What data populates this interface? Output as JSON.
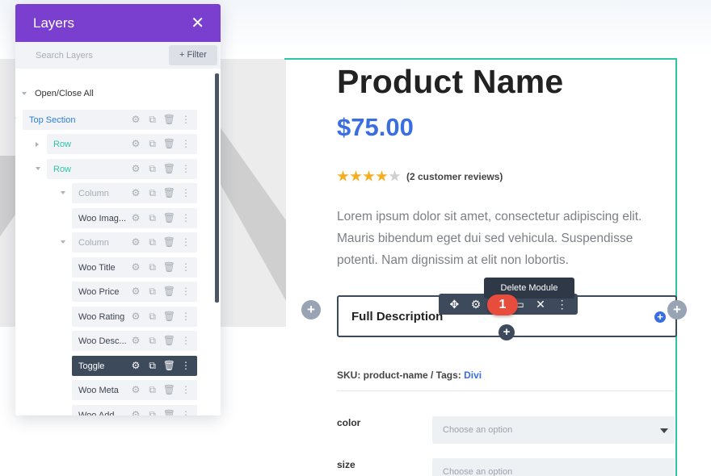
{
  "layers_panel": {
    "title": "Layers",
    "close_icon": "close-icon",
    "search_placeholder": "Search Layers",
    "filter_label": "+ Filter",
    "open_close_all": "Open/Close All",
    "items": [
      {
        "label": "Top Section",
        "type": "section",
        "expanded": true
      },
      {
        "label": "Row",
        "type": "row",
        "expanded": false
      },
      {
        "label": "Row",
        "type": "row",
        "expanded": true
      },
      {
        "label": "Column",
        "type": "column",
        "expanded": true
      },
      {
        "label": "Woo Imag...",
        "type": "module"
      },
      {
        "label": "Column",
        "type": "column",
        "expanded": true
      },
      {
        "label": "Woo Title",
        "type": "module"
      },
      {
        "label": "Woo Price",
        "type": "module"
      },
      {
        "label": "Woo Rating",
        "type": "module"
      },
      {
        "label": "Woo Desc...",
        "type": "module"
      },
      {
        "label": "Toggle",
        "type": "module",
        "active": true
      },
      {
        "label": "Woo Meta",
        "type": "module"
      },
      {
        "label": "Woo Add...",
        "type": "module"
      }
    ],
    "action_icons": [
      "gear-icon",
      "duplicate-icon",
      "trash-icon",
      "more-vertical-icon"
    ]
  },
  "product": {
    "name": "Product Name",
    "price": "$75.00",
    "rating": 4,
    "rating_max": 5,
    "reviews": "(2 customer reviews)",
    "description": "Lorem ipsum dolor sit amet, consectetur adipiscing elit. Mauris bibendum eget dui sed vehicula. Suspendisse potenti. Nam dignissim at elit non lobortis.",
    "sku_text": "SKU: product-name / Tags: ",
    "tag_link": "Divi",
    "attributes": [
      {
        "label": "color",
        "placeholder": "Choose an option"
      },
      {
        "label": "size",
        "placeholder": "Choose an option"
      }
    ]
  },
  "toggle_module": {
    "title": "Full Description",
    "toolbar_icons": [
      "move-icon",
      "gear-icon",
      "duplicate-icon",
      "save-icon",
      "delete-icon",
      "more-vertical-icon"
    ],
    "tooltip": "Delete Module",
    "step_badge": "1"
  },
  "colors": {
    "panel_header": "#7b3fd0",
    "section_outline": "#2ec4a8",
    "price": "#3a6ee0",
    "badge": "#e74c3c",
    "stars": "#f2b01e"
  }
}
